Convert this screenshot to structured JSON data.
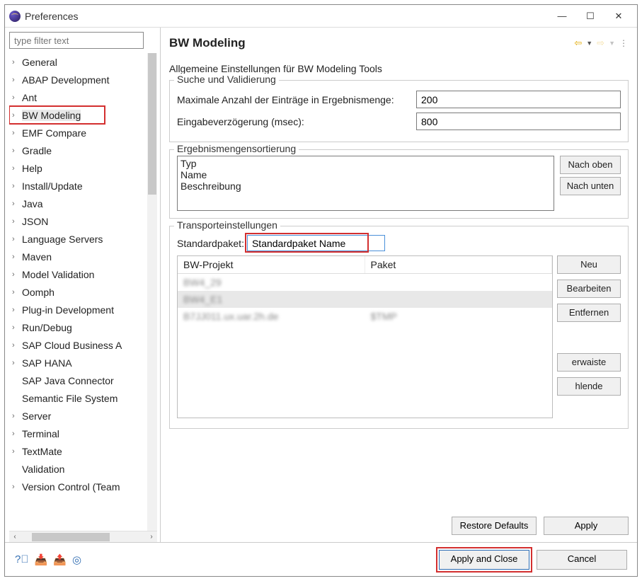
{
  "window": {
    "title": "Preferences"
  },
  "filter_placeholder": "type filter text",
  "tree": [
    {
      "label": "General",
      "exp": true
    },
    {
      "label": "ABAP Development",
      "exp": true
    },
    {
      "label": "Ant",
      "exp": true
    },
    {
      "label": "BW Modeling",
      "exp": true,
      "selected": true,
      "highlight": true
    },
    {
      "label": "EMF Compare",
      "exp": true
    },
    {
      "label": "Gradle",
      "exp": true
    },
    {
      "label": "Help",
      "exp": true
    },
    {
      "label": "Install/Update",
      "exp": true
    },
    {
      "label": "Java",
      "exp": true
    },
    {
      "label": "JSON",
      "exp": true
    },
    {
      "label": "Language Servers",
      "exp": true
    },
    {
      "label": "Maven",
      "exp": true
    },
    {
      "label": "Model Validation",
      "exp": true
    },
    {
      "label": "Oomph",
      "exp": true
    },
    {
      "label": "Plug-in Development",
      "exp": true
    },
    {
      "label": "Run/Debug",
      "exp": true
    },
    {
      "label": "SAP Cloud Business A",
      "exp": true
    },
    {
      "label": "SAP HANA",
      "exp": true
    },
    {
      "label": "SAP Java Connector",
      "exp": false
    },
    {
      "label": "Semantic File System",
      "exp": false
    },
    {
      "label": "Server",
      "exp": true
    },
    {
      "label": "Terminal",
      "exp": true
    },
    {
      "label": "TextMate",
      "exp": true
    },
    {
      "label": "Validation",
      "exp": false
    },
    {
      "label": "Version Control (Team",
      "exp": true
    }
  ],
  "page": {
    "title": "BW Modeling",
    "description": "Allgemeine Einstellungen für BW Modeling Tools",
    "group_search": {
      "legend": "Suche und Validierung",
      "max_entries_label": "Maximale Anzahl der Einträge in Ergebnismenge:",
      "max_entries_value": "200",
      "delay_label": "Eingabeverzögerung (msec):",
      "delay_value": "800"
    },
    "group_sort": {
      "legend": "Ergebnismengensortierung",
      "items": [
        "Typ",
        "Name",
        "Beschreibung"
      ],
      "btn_up": "Nach oben",
      "btn_down": "Nach unten"
    },
    "group_transport": {
      "legend": "Transporteinstellungen",
      "default_pkg_label": "Standardpaket:",
      "default_pkg_value": "Standardpaket Name",
      "col_project": "BW-Projekt",
      "col_package": "Paket",
      "rows": [
        {
          "project": "BW4_29",
          "package": ""
        },
        {
          "project": "BW4_E1",
          "package": ""
        },
        {
          "project": "B7JJ011.ux.uar.2h.de",
          "package": "$TMP"
        }
      ],
      "btn_new": "Neu",
      "btn_edit": "Bearbeiten",
      "btn_remove": "Entfernen",
      "btn_remove_orphan": "erwaiste entferne",
      "btn_add_missing": "hlende hinzufüg"
    },
    "btn_restore": "Restore Defaults",
    "btn_apply": "Apply"
  },
  "footer": {
    "apply_close": "Apply and Close",
    "cancel": "Cancel"
  }
}
